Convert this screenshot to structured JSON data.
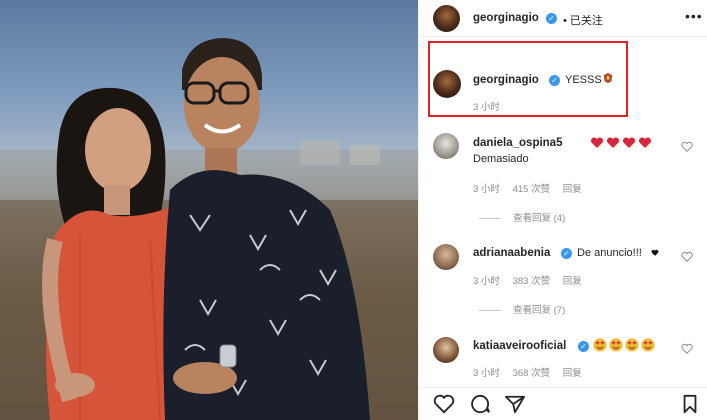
{
  "post": {
    "author": "georginagio",
    "follow_state": "• 已关注"
  },
  "caption": {
    "username": "georginagio",
    "text": "YESSS",
    "time": "3 小时"
  },
  "comments": [
    {
      "username": "daniela_ospina5",
      "text": "Demasiado",
      "time": "3 小时",
      "likes": "415 次赞",
      "reply": "回复",
      "view_replies": "查看回复 (4)"
    },
    {
      "username": "adrianaabenia",
      "text": "De anuncio!!!",
      "time": "3 小时",
      "likes": "383 次赞",
      "reply": "回复",
      "view_replies": "查看回复 (7)"
    },
    {
      "username": "katiaaveirooficial",
      "time": "3 小时",
      "likes": "368 次赞",
      "reply": "回复"
    }
  ],
  "icons": {
    "verified": "verified-badge-icon",
    "like": "heart-icon",
    "comment": "comment-icon",
    "share": "share-icon",
    "save": "bookmark-icon",
    "more": "more-options-icon"
  },
  "colors": {
    "verified": "#3897f0",
    "highlight_box": "#e02424",
    "emoji_heart": "#d7263d"
  }
}
